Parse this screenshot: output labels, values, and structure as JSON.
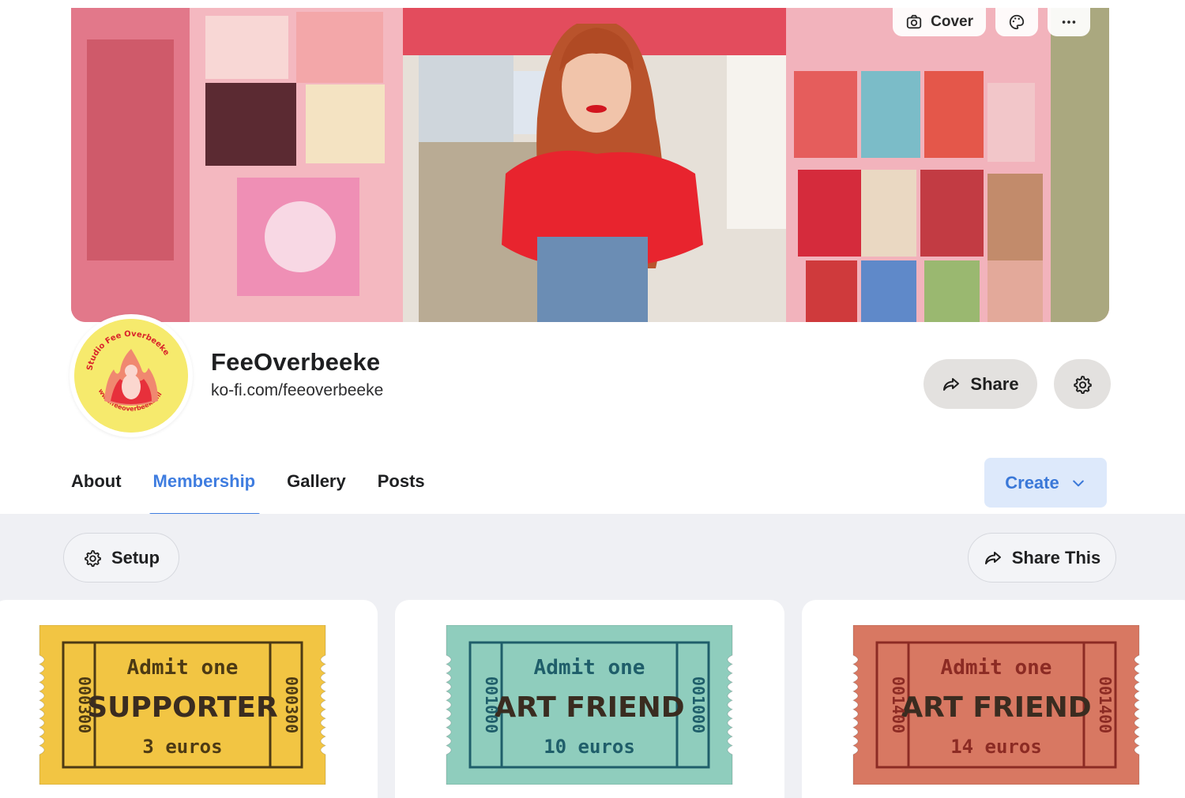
{
  "cover": {
    "cover_button_label": "Cover",
    "cover_button_icon": "camera-icon",
    "theme_button_icon": "palette-icon",
    "more_button_icon": "more-dots-icon"
  },
  "profile": {
    "name": "FeeOverbeeke",
    "url": "ko-fi.com/feeoverbeeke",
    "share_label": "Share",
    "share_icon": "share-arrow-icon",
    "settings_icon": "gear-icon",
    "avatar_ring_text_top": "Studio Fee Overbeeke",
    "avatar_ring_text_bottom": "www.feeoverbeeke.nl"
  },
  "tabs": [
    {
      "label": "About",
      "active": false
    },
    {
      "label": "Membership",
      "active": true
    },
    {
      "label": "Gallery",
      "active": false
    },
    {
      "label": "Posts",
      "active": false
    }
  ],
  "create": {
    "label": "Create",
    "icon": "chevron-down-icon"
  },
  "membership": {
    "setup_label": "Setup",
    "share_this_label": "Share This",
    "tiers": [
      {
        "admit": "Admit one",
        "name": "SUPPORTER",
        "price": "3 euros",
        "serial": "000300",
        "color": "#f2c543",
        "ink": "#4d3a14"
      },
      {
        "admit": "Admit one",
        "name": "ART FRIEND",
        "price": "10 euros",
        "serial": "001000",
        "color": "#8fcdbd",
        "ink": "#1f5e6a"
      },
      {
        "admit": "Admit one",
        "name": "ART FRIEND",
        "price": "14 euros",
        "serial": "001400",
        "color": "#d87862",
        "ink": "#8c2b24"
      }
    ]
  },
  "colors": {
    "accent": "#3f7de0",
    "create_bg": "#dde9fb",
    "panel_bg": "#eff0f4",
    "button_grey": "#e3e1df"
  }
}
